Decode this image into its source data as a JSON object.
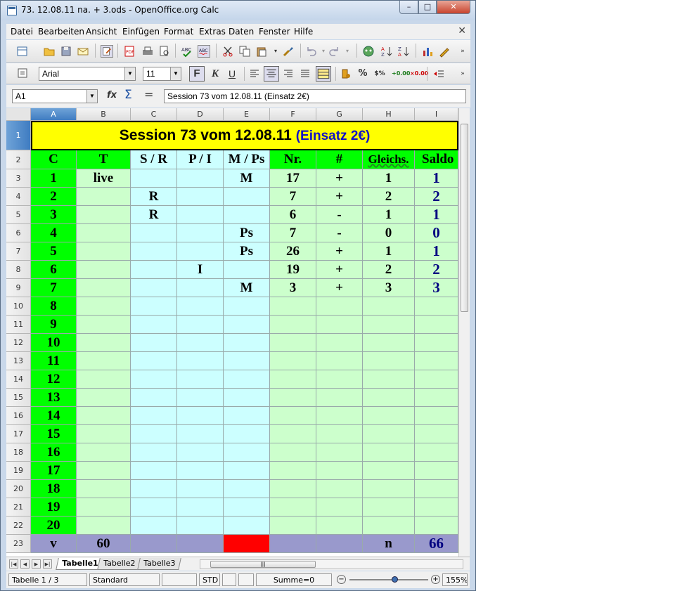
{
  "window": {
    "title": "73. 12.08.11 na. + 3.ods - OpenOffice.org Calc",
    "minimize": "–",
    "maximize": "□",
    "close": "✕"
  },
  "menu": [
    "Datei",
    "Bearbeiten",
    "Ansicht",
    "Einfügen",
    "Format",
    "Extras",
    "Daten",
    "Fenster",
    "Hilfe"
  ],
  "doc_close": "✕",
  "format_toolbar": {
    "font_name": "Arial",
    "font_size": "11",
    "bold": "F",
    "italic": "K",
    "underline": "U"
  },
  "formula_bar": {
    "cell_ref": "A1",
    "fx": "fx",
    "sum": "Σ",
    "equals": "=",
    "content": "Session 73 vom 12.08.11 (Einsatz 2€)"
  },
  "columns": [
    "A",
    "B",
    "C",
    "D",
    "E",
    "F",
    "G",
    "H",
    "I"
  ],
  "rows": [
    "1",
    "2",
    "3",
    "4",
    "5",
    "6",
    "7",
    "8",
    "9",
    "10",
    "11",
    "12",
    "13",
    "14",
    "15",
    "16",
    "17",
    "18",
    "19",
    "20",
    "21",
    "22",
    "23"
  ],
  "sheet": {
    "title_main": "Session 73 vom 12.08.11 ",
    "title_stake": "(Einsatz 2€)",
    "headers": [
      "C",
      "T",
      "S / R",
      "P / I",
      "M / Ps",
      "Nr.",
      "#",
      "Gleichs.",
      "Saldo"
    ],
    "data_rows": [
      [
        "1",
        "live",
        "",
        "",
        "M",
        "17",
        "+",
        "1",
        "1"
      ],
      [
        "2",
        "",
        "R",
        "",
        "",
        "7",
        "+",
        "2",
        "2"
      ],
      [
        "3",
        "",
        "R",
        "",
        "",
        "6",
        "-",
        "1",
        "1"
      ],
      [
        "4",
        "",
        "",
        "",
        "Ps",
        "7",
        "-",
        "0",
        "0"
      ],
      [
        "5",
        "",
        "",
        "",
        "Ps",
        "26",
        "+",
        "1",
        "1"
      ],
      [
        "6",
        "",
        "",
        "I",
        "",
        "19",
        "+",
        "2",
        "2"
      ],
      [
        "7",
        "",
        "",
        "",
        "M",
        "3",
        "+",
        "3",
        "3"
      ],
      [
        "8",
        "",
        "",
        "",
        "",
        "",
        "",
        "",
        ""
      ],
      [
        "9",
        "",
        "",
        "",
        "",
        "",
        "",
        "",
        ""
      ],
      [
        "10",
        "",
        "",
        "",
        "",
        "",
        "",
        "",
        ""
      ],
      [
        "11",
        "",
        "",
        "",
        "",
        "",
        "",
        "",
        ""
      ],
      [
        "12",
        "",
        "",
        "",
        "",
        "",
        "",
        "",
        ""
      ],
      [
        "13",
        "",
        "",
        "",
        "",
        "",
        "",
        "",
        ""
      ],
      [
        "14",
        "",
        "",
        "",
        "",
        "",
        "",
        "",
        ""
      ],
      [
        "15",
        "",
        "",
        "",
        "",
        "",
        "",
        "",
        ""
      ],
      [
        "16",
        "",
        "",
        "",
        "",
        "",
        "",
        "",
        ""
      ],
      [
        "17",
        "",
        "",
        "",
        "",
        "",
        "",
        "",
        ""
      ],
      [
        "18",
        "",
        "",
        "",
        "",
        "",
        "",
        "",
        ""
      ],
      [
        "19",
        "",
        "",
        "",
        "",
        "",
        "",
        "",
        ""
      ],
      [
        "20",
        "",
        "",
        "",
        "",
        "",
        "",
        "",
        ""
      ]
    ],
    "footer": [
      "v",
      "60",
      "",
      "",
      "",
      "",
      "",
      "n",
      "66"
    ]
  },
  "colors": {
    "green": "#00ff00",
    "light_green": "#ccffcc",
    "light_cyan": "#ccffff",
    "yellow": "#ffff00",
    "footer": "#9999cc",
    "red": "#ff0000",
    "saldo_blue": "#000080"
  },
  "tabs": [
    "Tabelle1",
    "Tabelle2",
    "Tabelle3"
  ],
  "status": {
    "sheet": "Tabelle 1 / 3",
    "style": "Standard",
    "mode": "STD",
    "sum": "Summe=0",
    "zoom": "155%"
  }
}
